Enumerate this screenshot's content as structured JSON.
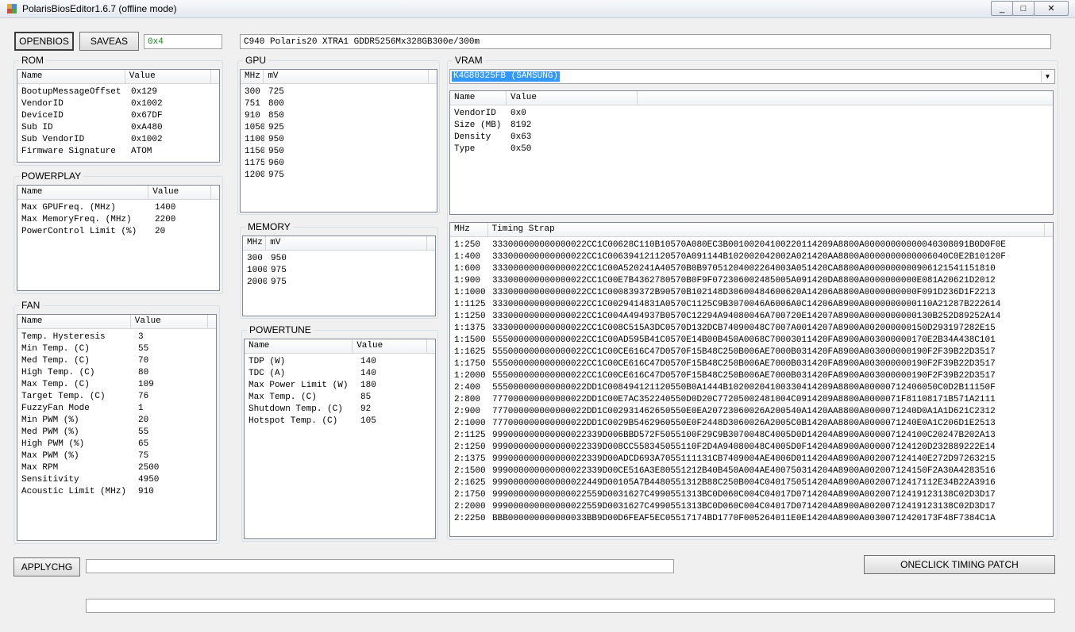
{
  "window": {
    "title": "PolarisBiosEditor 1.6.7 (offline mode)",
    "minimize": "_",
    "maximize": "□",
    "close": "✕"
  },
  "toolbar": {
    "open_label": "OPEN BIOS",
    "saveas_label": "SAVE AS",
    "checksum_value": "0x4",
    "bios_info": "C940 Polaris20 XTR A1 GDDR5 256Mx32 8GB 300e/300m"
  },
  "rom": {
    "title": "ROM",
    "headers": [
      "Name",
      "Value"
    ],
    "rows": [
      [
        "BootupMessageOffset",
        "0x129"
      ],
      [
        "VendorID",
        "0x1002"
      ],
      [
        "DeviceID",
        "0x67DF"
      ],
      [
        "Sub ID",
        "0xA480"
      ],
      [
        "Sub VendorID",
        "0x1002"
      ],
      [
        "Firmware Signature",
        "ATOM"
      ]
    ]
  },
  "powerplay": {
    "title": "POWERPLAY",
    "headers": [
      "Name",
      "Value"
    ],
    "rows": [
      [
        "Max GPU Freq. (MHz)",
        "1400"
      ],
      [
        "Max Memory Freq. (MHz)",
        "2200"
      ],
      [
        "Power Control Limit (%)",
        "20"
      ]
    ]
  },
  "fan": {
    "title": "FAN",
    "headers": [
      "Name",
      "Value"
    ],
    "rows": [
      [
        "Temp. Hysteresis",
        "3"
      ],
      [
        "Min Temp. (C)",
        "55"
      ],
      [
        "Med Temp. (C)",
        "70"
      ],
      [
        "High Temp. (C)",
        "80"
      ],
      [
        "Max Temp. (C)",
        "109"
      ],
      [
        "Target Temp. (C)",
        "76"
      ],
      [
        "Fuzzy Fan Mode",
        "1"
      ],
      [
        "Min PWM (%)",
        "20"
      ],
      [
        "Med PWM (%)",
        "55"
      ],
      [
        "High PWM (%)",
        "65"
      ],
      [
        "Max PWM (%)",
        "75"
      ],
      [
        "Max RPM",
        "2500"
      ],
      [
        "Sensitivity",
        "4950"
      ],
      [
        "Acoustic Limit (MHz)",
        "910"
      ]
    ]
  },
  "gpu": {
    "title": "GPU",
    "headers": [
      "MHz",
      "mV"
    ],
    "rows": [
      [
        "300",
        "725"
      ],
      [
        "751",
        "800"
      ],
      [
        "910",
        "850"
      ],
      [
        "1050",
        "925"
      ],
      [
        "1100",
        "950"
      ],
      [
        "1150",
        "950"
      ],
      [
        "1175",
        "960"
      ],
      [
        "1200",
        "975"
      ]
    ]
  },
  "memory": {
    "title": "MEMORY",
    "headers": [
      "MHz",
      "mV"
    ],
    "rows": [
      [
        "300",
        "950"
      ],
      [
        "1000",
        "975"
      ],
      [
        "2000",
        "975"
      ]
    ]
  },
  "powertune": {
    "title": "POWERTUNE",
    "headers": [
      "Name",
      "Value"
    ],
    "rows": [
      [
        "TDP (W)",
        "140"
      ],
      [
        "TDC (A)",
        "140"
      ],
      [
        "Max Power Limit (W)",
        "180"
      ],
      [
        "Max Temp. (C)",
        "85"
      ],
      [
        "Shutdown Temp. (C)",
        "92"
      ],
      [
        "Hotspot Temp. (C)",
        "105"
      ]
    ]
  },
  "vram": {
    "title": "VRAM",
    "selected_chip": "K4G80325FB (SAMSUNG)",
    "headers": [
      "Name",
      "Value"
    ],
    "rows": [
      [
        "VendorID",
        "0x0"
      ],
      [
        "Size (MB)",
        "8192"
      ],
      [
        "Density",
        "0x63"
      ],
      [
        "Type",
        "0x50"
      ]
    ]
  },
  "timings": {
    "headers": [
      "MHz",
      "Timing Strap"
    ],
    "rows": [
      [
        "1:250",
        "333000000000000022CC1C00628C110B10570A080EC3B0010020410022011420​9A8800A00000000000040308091B0D0F0E"
      ],
      [
        "1:400",
        "333000000000000022CC1C006394121120570A091144B10200204200​2A021420AA8800A0000000000006040C0E2B10120F"
      ],
      [
        "1:600",
        "333000000000000022CC1C00A520241A40570B0B97051204002264003A051420CA8800A0000000000906121541151810"
      ],
      [
        "1:900",
        "333000000000000022CC1C00E7B4362780570B0F9F0723060024850​05A091420DA8800A0000000000E081A20621D2012"
      ],
      [
        "1:1000",
        "333000000000000022CC1C000839372B90570B102148D30600484600620A14206A8800A0000000000F091D236D1F2213"
      ],
      [
        "1:1125",
        "333000000000000022CC1C0029414831A0570C1125C9B3070046A6006A0C14206A8900A0000000000110A21287B222614"
      ],
      [
        "1:1250",
        "333000000000000022CC1C004A494937B0570C12294A9408004 6A700720E14207A8900A0000000000130B252D89252A14"
      ],
      [
        "1:1375",
        "333000000000000022CC1C008C515A3DC0570D132DCB74090048C7007A0014207A8900A002000000150D293197282E15"
      ],
      [
        "1:1500",
        "555000000000000022CC1C00AD595B41C0570E14B00B450A0068C70003011420FA8900A003000000170E2B34A438C101"
      ],
      [
        "1:1625",
        "555000000000000022CC1C00CE616C47D0570F15B48C250B006AE7000B031420FA8900A003000000190F2F39B22D3517"
      ],
      [
        "1:1750",
        "555000000000000022CC1C00CE616C47D0570F15B48C250B006AE7000B031420FA8900A003000000190F2F39B22D3517"
      ],
      [
        "1:2000",
        "555000000000000022CC1C00CE616C47D0570F15B48C250B006AE7000B031420FA8900A003000000190F2F39B22D3517"
      ],
      [
        "2:400",
        "555000000000000022DD1C008494121120550B0A1444B1020020410033041420 9A8800A00000712406050C0D2B11150F"
      ],
      [
        "2:800",
        "777000000000000022DD1C00E7AC352240550D0D20C7720500248100 4C0914209A8800A0000071F81108171B571A2111"
      ],
      [
        "2:900",
        "777000000000000022DD1C0029314626505 50E0EA20723060026A200540A1420AA8800A0000071240D0A1A1D621C2312"
      ],
      [
        "2:1000",
        "777000000000000022DD1C0029B5462960550E0F2448D3060026A2005C0B1420AA8800A0000071240E0A1C206D1E2513"
      ],
      [
        "2:1125",
        "999000000000000022339D006BBD572F5055 100F29C9B3070048C4005D0D14204A8900A000007124100C20247B202A13"
      ],
      [
        "2:1250",
        "999000000000000022339D008CC55834505 5110F2D4A94080048C4005D0F14204A8900A0000071241 20D232889222E14"
      ],
      [
        "2:1375",
        "999000000000000022339D00ADCD693A7055111131CB7409004AE4006D0114204A8900A0020071 24140E272D97263215"
      ],
      [
        "2:1500",
        "999000000000000022339D00CE516A3E80551212B40B450A004AE4007 50314204A8900A0020071241 50F2A30A4283516"
      ],
      [
        "2:1625",
        "999000000000000022449D00105A7B4480551312B88C250B004C0401750514204A8900A0020071241 7112E34B22A3916"
      ],
      [
        "2:1750",
        "99900000000000002255 9D0031627C4990551313BC0D060C004C04017D0714204A8900A0020071241 9123138C02D3D17"
      ],
      [
        "2:2000",
        "99900000000000002255 9D0031627C4990551313BC0D060C004C04017D0714204A8900A0020071241 9123138C02D3D17"
      ],
      [
        "2:2250",
        "BBB000000000000033BB9D00D6FEAF5EC05517174BD1770F005264011E0E14204A8900A003007124 20173F48F7384C1A"
      ]
    ]
  },
  "bottom": {
    "apply_label": "APPLY CHG",
    "apply_text": "",
    "patch_label": "ONE CLICK TIMING PATCH",
    "status_text": ""
  }
}
